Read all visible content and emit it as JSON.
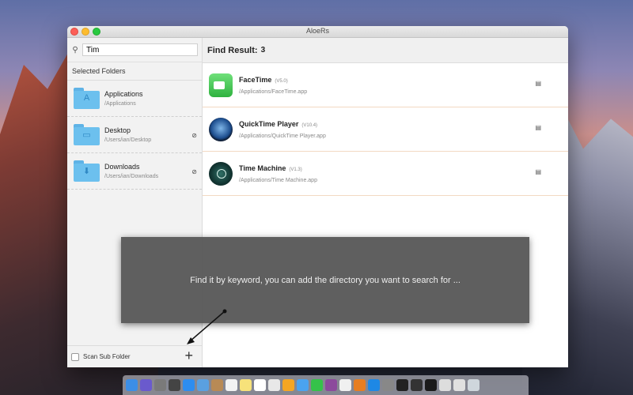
{
  "window": {
    "title": "AloeRs"
  },
  "search": {
    "value": "Tim",
    "icon": "search-icon"
  },
  "sidebar": {
    "section_title": "Selected Folders",
    "folders": [
      {
        "name": "Applications",
        "path": "/Applications",
        "glyph": "A",
        "removable": false
      },
      {
        "name": "Desktop",
        "path": "/Users/ian/Desktop",
        "glyph": "▭",
        "removable": true
      },
      {
        "name": "Downloads",
        "path": "/Users/ian/Downloads",
        "glyph": "⬇",
        "removable": true
      }
    ],
    "scan_sub_folder_label": "Scan Sub Folder",
    "scan_sub_folder_checked": false,
    "add_symbol": "+"
  },
  "results": {
    "label": "Find Result:",
    "count": "3",
    "items": [
      {
        "name": "FaceTime",
        "version": "(V5.0)",
        "path": "/Applications/FaceTime.app",
        "icon": "facetime-icon"
      },
      {
        "name": "QuickTime Player",
        "version": "(V10.4)",
        "path": "/Applications/QuickTime Player.app",
        "icon": "quicktime-icon"
      },
      {
        "name": "Time Machine",
        "version": "(V1.3)",
        "path": "/Applications/Time Machine.app",
        "icon": "timemachine-icon"
      }
    ]
  },
  "overlay": {
    "text": "Find it by keyword, you can add the directory you want to search for ..."
  },
  "colors": {
    "accent_folder": "#6cc0ee",
    "row_divider": "#f2d9c2",
    "overlay_bg": "#5a5a5a"
  }
}
